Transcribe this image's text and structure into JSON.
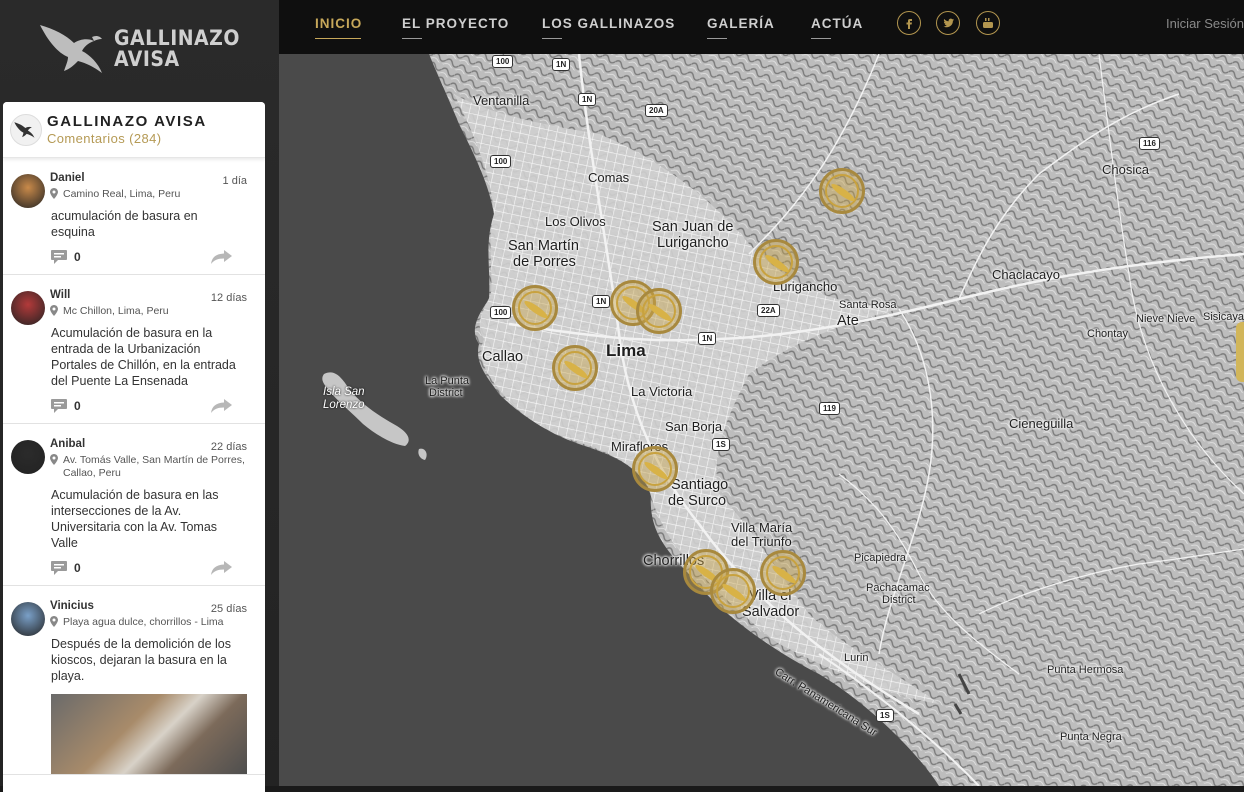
{
  "sidebar": {
    "logo_line1": "GALLINAZO",
    "logo_line2": "AVISA",
    "panel_title": "GALLINAZO AVISA",
    "panel_subtitle": "Comentarios (284)",
    "posts": [
      {
        "name": "Daniel",
        "time": "1 día",
        "location": "Camino Real, Lima, Peru",
        "text": "acumulación de basura en esquina",
        "comments": "0",
        "avatar_color": "#c98a4a"
      },
      {
        "name": "Will",
        "time": "12 días",
        "location": "Mc Chillon, Lima, Peru",
        "text": "Acumulación de basura en la entrada de la Urbanización Portales de Chillón, en la entrada del Puente La Ensenada",
        "comments": "0",
        "avatar_color": "#b33a3a"
      },
      {
        "name": "Anibal",
        "time": "22 días",
        "location": "Av. Tomás Valle, San Martín de Porres, Callao, Peru",
        "text": "Acumulación de basura en las intersecciones de la Av. Universitaria con la Av. Tomas Valle",
        "comments": "0",
        "avatar_color": "#2b2b2b"
      },
      {
        "name": "Vinicius",
        "time": "25 días",
        "location": "Playa agua dulce, chorrillos - Lima",
        "text": "Después de la demolición de los kioscos, dejaran la basura en la playa.",
        "comments": "",
        "avatar_color": "#7aa0c8"
      }
    ]
  },
  "nav": {
    "items": [
      "INICIO",
      "EL PROYECTO",
      "LOS GALLINAZOS",
      "GALERÍA",
      "ACTÚA"
    ],
    "active": "INICIO",
    "login": "Iniciar Sesión"
  },
  "map": {
    "labels": {
      "ventanilla": "Ventanilla",
      "comas": "Comas",
      "los_olivos": "Los Olivos",
      "smp1": "San Martín",
      "smp2": "de Porres",
      "sjl1": "San Juan de",
      "sjl2": "Lurigancho",
      "chosica": "Chosica",
      "chaclacayo": "Chaclacayo",
      "lurigancho": "Lurigancho",
      "santa_rosa": "Santa Rosa",
      "ate": "Ate",
      "chontay": "Chontay",
      "nieve": "Nieve Nieve",
      "sisicaya": "Sisicaya",
      "callao": "Callao",
      "lima": "Lima",
      "la_punta1": "La Punta",
      "la_punta2": "District",
      "isla1": "Isla San",
      "isla2": "Lorenzo",
      "la_victoria": "La Victoria",
      "san_borja": "San Borja",
      "miraflores": "Miraflores",
      "surco1": "Santiago",
      "surco2": "de Surco",
      "cieneguilla": "Cieneguilla",
      "vmt1": "Villa María",
      "vmt2": "del Triunfo",
      "chorrillos": "Chorrillos",
      "ves1": "Villa el",
      "ves2": "Salvador",
      "picapiedra": "Picapiedra",
      "pachacamac1": "Pachacamac",
      "pachacamac2": "District",
      "lurin": "Lurin",
      "panamericana": "Carr. Panamericana Sur",
      "punta_hermosa": "Punta Hermosa",
      "punta_negra": "Punta Negra"
    },
    "shields": {
      "s100a": "100",
      "s1na": "1N",
      "s1nb": "1N",
      "s20a": "20A",
      "s100b": "100",
      "s116": "116",
      "s100c": "100",
      "s1nc": "1N",
      "s22a": "22A",
      "s1nd": "1N",
      "s119": "119",
      "s1sa": "1S",
      "s1sb": "1S"
    }
  }
}
